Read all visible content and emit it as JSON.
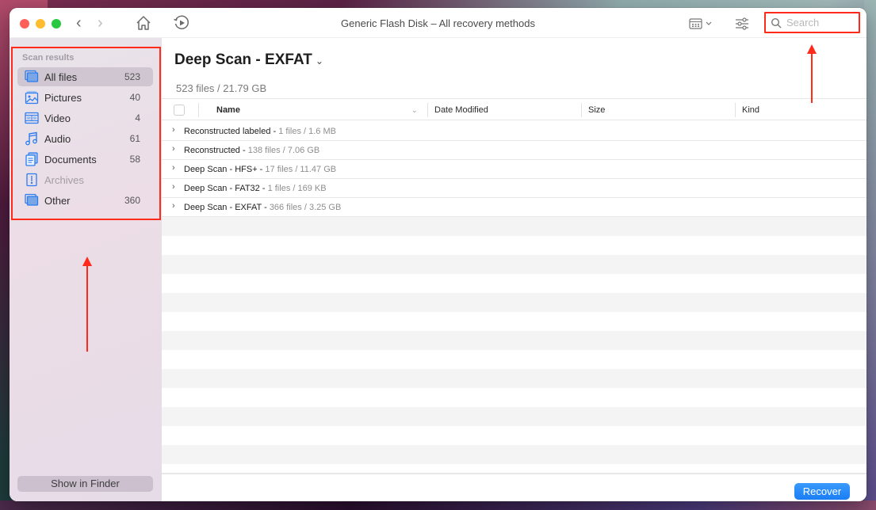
{
  "window": {
    "title": "Generic Flash Disk – All recovery methods"
  },
  "toolbar": {
    "back_label": "‹",
    "forward_label": "›",
    "search_placeholder": "Search",
    "search_value": ""
  },
  "sidebar": {
    "header": "Scan results",
    "items": [
      {
        "label": "All files",
        "count": "523",
        "icon": "all-files-icon",
        "active": true
      },
      {
        "label": "Pictures",
        "count": "40",
        "icon": "pictures-icon"
      },
      {
        "label": "Video",
        "count": "4",
        "icon": "video-icon"
      },
      {
        "label": "Audio",
        "count": "61",
        "icon": "audio-icon"
      },
      {
        "label": "Documents",
        "count": "58",
        "icon": "documents-icon"
      },
      {
        "label": "Archives",
        "count": "",
        "icon": "archives-icon",
        "disabled": true
      },
      {
        "label": "Other",
        "count": "360",
        "icon": "other-icon"
      }
    ],
    "show_in_finder_label": "Show in Finder"
  },
  "main": {
    "title": "Deep Scan - EXFAT",
    "title_chevron": "⌄",
    "subtitle": "523 files / 21.79 GB",
    "columns": {
      "name": "Name",
      "date_modified": "Date Modified",
      "size": "Size",
      "kind": "Kind"
    },
    "rows": [
      {
        "name": "Reconstructed labeled - ",
        "meta": "1 files / 1.6 MB"
      },
      {
        "name": "Reconstructed - ",
        "meta": "138 files / 7.06 GB"
      },
      {
        "name": "Deep Scan - HFS+ - ",
        "meta": "17 files / 11.47 GB"
      },
      {
        "name": "Deep Scan - FAT32 - ",
        "meta": "1 files / 169 KB"
      },
      {
        "name": "Deep Scan - EXFAT - ",
        "meta": "366 files / 3.25 GB"
      }
    ],
    "recover_label": "Recover"
  },
  "colors": {
    "accent": "#1a7ef5",
    "annotation": "#ff2a1a",
    "icon_blue": "#2a7df0"
  }
}
